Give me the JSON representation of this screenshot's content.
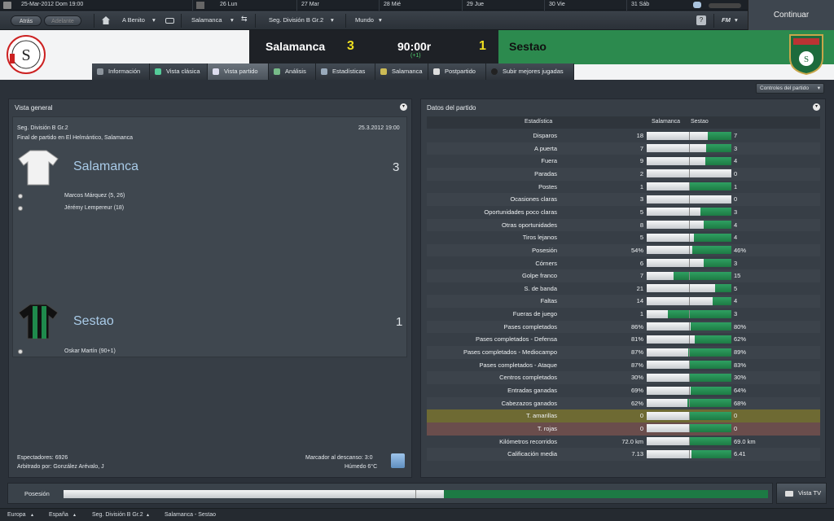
{
  "calendar": {
    "current": "25-Mar-2012  Dom  19:00",
    "days": [
      "26  Lun",
      "27  Mar",
      "28  Mié",
      "29  Jue",
      "30  Vie",
      "31  Sáb"
    ]
  },
  "continue_label": "Continuar",
  "nav": {
    "back": "Atrás",
    "forward": "Adelante",
    "manager": "A Benito",
    "team": "Salamanca",
    "competition": "Seg. División B Gr.2",
    "world": "Mundo",
    "help": "?",
    "fm": "FM"
  },
  "match": {
    "home_team": "Salamanca",
    "away_team": "Sestao",
    "home_score": "3",
    "away_score": "1",
    "clock": "90:00r",
    "added": "(+1)"
  },
  "tabs": [
    "Información",
    "Vista clásica",
    "Vista partido",
    "Análisis",
    "Estadísticas",
    "Salamanca",
    "Postpartido",
    "Subir mejores jugadas"
  ],
  "active_tab": 2,
  "match_controls": "Controles del partido",
  "overview": {
    "title": "Vista general",
    "competition": "Seg. División B Gr.2",
    "date": "25.3.2012 19:00",
    "venue": "Final de partido en El Helmántico, Salamanca",
    "home_name": "Salamanca",
    "home_goals": "3",
    "home_scorers": [
      "Marcos Márquez (5, 26)",
      "Jérémy Lempereur (18)"
    ],
    "away_name": "Sestao",
    "away_goals": "1",
    "away_scorers": [
      "Oskar Martín (90+1)"
    ],
    "attendance": "Espectadores: 6926",
    "referee": "Arbitrado por: González Arévalo, J",
    "halftime": "Marcador al descanso: 3:0",
    "weather": "Húmedo 6°C"
  },
  "stats": {
    "title": "Datos del partido",
    "col_stat": "Estadística",
    "col_home": "Salamanca",
    "col_away": "Sestao",
    "rows": [
      {
        "label": "Disparos",
        "home": "18",
        "away": "7",
        "share": 0.72
      },
      {
        "label": "A puerta",
        "home": "7",
        "away": "3",
        "share": 0.7
      },
      {
        "label": "Fuera",
        "home": "9",
        "away": "4",
        "share": 0.69
      },
      {
        "label": "Paradas",
        "home": "2",
        "away": "0",
        "share": 1.0
      },
      {
        "label": "Postes",
        "home": "1",
        "away": "1",
        "share": 0.5
      },
      {
        "label": "Ocasiones claras",
        "home": "3",
        "away": "0",
        "share": 1.0
      },
      {
        "label": "Oportunidades poco claras",
        "home": "5",
        "away": "3",
        "share": 0.63
      },
      {
        "label": "Otras oportunidades",
        "home": "8",
        "away": "4",
        "share": 0.67
      },
      {
        "label": "Tiros lejanos",
        "home": "5",
        "away": "4",
        "share": 0.56
      },
      {
        "label": "Posesión",
        "home": "54%",
        "away": "46%",
        "share": 0.54
      },
      {
        "label": "Córners",
        "home": "6",
        "away": "3",
        "share": 0.67
      },
      {
        "label": "Golpe franco",
        "home": "7",
        "away": "15",
        "share": 0.32
      },
      {
        "label": "S. de banda",
        "home": "21",
        "away": "5",
        "share": 0.81
      },
      {
        "label": "Faltas",
        "home": "14",
        "away": "4",
        "share": 0.78
      },
      {
        "label": "Fueras de juego",
        "home": "1",
        "away": "3",
        "share": 0.25
      },
      {
        "label": "Pases completados",
        "home": "86%",
        "away": "80%",
        "share": 0.52
      },
      {
        "label": "Pases completados - Defensa",
        "home": "81%",
        "away": "62%",
        "share": 0.57
      },
      {
        "label": "Pases completados - Mediocampo",
        "home": "87%",
        "away": "89%",
        "share": 0.49
      },
      {
        "label": "Pases completados - Ataque",
        "home": "87%",
        "away": "83%",
        "share": 0.51
      },
      {
        "label": "Centros completados",
        "home": "30%",
        "away": "30%",
        "share": 0.5
      },
      {
        "label": "Entradas ganadas",
        "home": "69%",
        "away": "64%",
        "share": 0.52
      },
      {
        "label": "Cabezazos ganados",
        "home": "62%",
        "away": "68%",
        "share": 0.48
      },
      {
        "label": "T. amarillas",
        "home": "0",
        "away": "0",
        "share": 0.5,
        "highlight": "#6e6a33"
      },
      {
        "label": "T. rojas",
        "home": "0",
        "away": "0",
        "share": 0.5,
        "highlight": "#6a4d4c"
      },
      {
        "label": "Kilómetros recorridos",
        "home": "72.0 km",
        "away": "69.0 km",
        "share": 0.51
      },
      {
        "label": "Calificación media",
        "home": "7.13",
        "away": "6.41",
        "share": 0.53
      }
    ]
  },
  "possession_label": "Posesión",
  "possession_home": 0.54,
  "vista_tv": "Vista TV",
  "breadcrumbs": [
    "Europa",
    "España",
    "Seg. División B Gr.2",
    "Salamanca - Sestao"
  ],
  "colors": {
    "home": "#e9ebed",
    "away": "#2c8a4e",
    "accent_score": "#f0e020"
  }
}
